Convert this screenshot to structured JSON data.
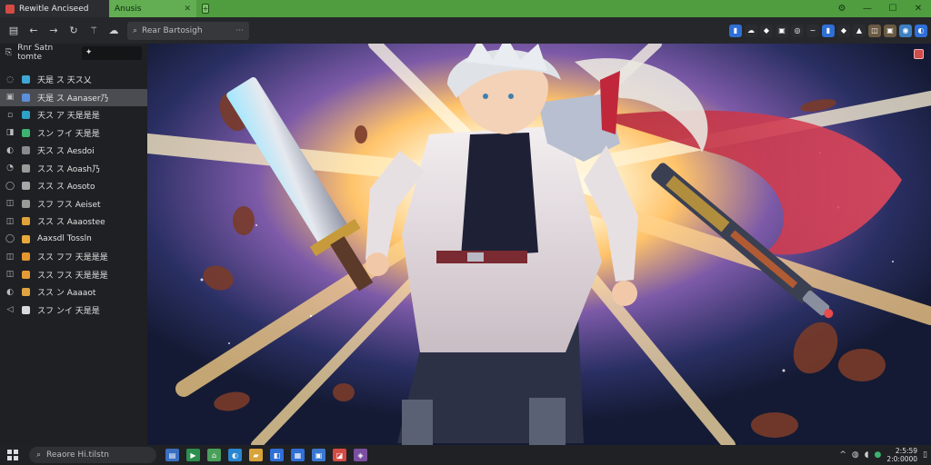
{
  "tabs": [
    {
      "label": "Rewitle Anciseed",
      "active": true
    },
    {
      "label": "Anusis",
      "active": false
    }
  ],
  "window_controls": {
    "settings": "⚙",
    "minimize": "—",
    "maximize": "☐",
    "close": "✕"
  },
  "toolbar": {
    "address_text": "Rear Bartosigh",
    "address_more": "···"
  },
  "sidebar": {
    "header_label": "Rnr Satn tomte",
    "search_value": "✦",
    "items": [
      {
        "glyph": "◌",
        "icon_color": "#3fa7d6",
        "label": "天是 ス 天ス乂"
      },
      {
        "glyph": "▣",
        "icon_color": "#5b8fd9",
        "label": "天是 ス Aanaser乃",
        "active": true
      },
      {
        "glyph": "▫",
        "icon_color": "#2ea1c9",
        "label": "天ス ア 天是是是"
      },
      {
        "glyph": "◨",
        "icon_color": "#3cb371",
        "label": "スン フイ 天是是"
      },
      {
        "glyph": "◐",
        "icon_color": "#8a8a8a",
        "label": "天ス ス Aesdoi"
      },
      {
        "glyph": "◔",
        "icon_color": "#9a9a9a",
        "label": "スス ス Aoash乃"
      },
      {
        "glyph": "◯",
        "icon_color": "#a7a7a7",
        "label": "スス ス Aosoto"
      },
      {
        "glyph": "◫",
        "icon_color": "#9a9a9a",
        "label": "スフ フス Aeiset"
      },
      {
        "glyph": "◫",
        "icon_color": "#e0a33a",
        "label": "スス ス Aaaostee"
      },
      {
        "glyph": "◯",
        "icon_color": "#e7a93b",
        "label": "Aaxsdl Tossln"
      },
      {
        "glyph": "◫",
        "icon_color": "#e6962f",
        "label": "スス フフ 天是是是"
      },
      {
        "glyph": "◫",
        "icon_color": "#e69a35",
        "label": "スス フス 天是是是"
      },
      {
        "glyph": "◐",
        "icon_color": "#e1a341",
        "label": "スス ン Aaaaot"
      },
      {
        "glyph": "◁",
        "icon_color": "#d9d9d9",
        "label": "スフ ンイ 天是是"
      }
    ]
  },
  "extensions": [
    {
      "name": "ext-1",
      "color": "#2f6fd6",
      "glyph": "▮"
    },
    {
      "name": "ext-2",
      "color": "#2a2c2f",
      "glyph": "☁"
    },
    {
      "name": "ext-3",
      "color": "#2a2c2f",
      "glyph": "◆"
    },
    {
      "name": "ext-4",
      "color": "#2a2c2f",
      "glyph": "▣"
    },
    {
      "name": "ext-5",
      "color": "#2a2c2f",
      "glyph": "◎"
    },
    {
      "name": "ext-6",
      "color": "#2a2c2f",
      "glyph": "~"
    },
    {
      "name": "ext-7",
      "color": "#2f6fd6",
      "glyph": "▮"
    },
    {
      "name": "ext-8",
      "color": "#2a2c2f",
      "glyph": "◆"
    },
    {
      "name": "ext-9",
      "color": "#2a2c2f",
      "glyph": "▲"
    },
    {
      "name": "ext-10",
      "color": "#6a5a43",
      "glyph": "◫"
    },
    {
      "name": "ext-11",
      "color": "#6a5a43",
      "glyph": "▣"
    },
    {
      "name": "ext-12",
      "color": "#3e7fc2",
      "glyph": "◉"
    },
    {
      "name": "ext-13",
      "color": "#2f6fd6",
      "glyph": "◐"
    }
  ],
  "taskbar": {
    "search_text": "Reaore Hi.tilstn",
    "clock_time": "2:5:59",
    "clock_date": "2:0:0000",
    "apps": [
      {
        "color": "#3a6fc1",
        "glyph": "▤"
      },
      {
        "color": "#2d8f4e",
        "glyph": "▶"
      },
      {
        "color": "#4aa05b",
        "glyph": "⌂"
      },
      {
        "color": "#2b86d1",
        "glyph": "◐"
      },
      {
        "color": "#d8a33a",
        "glyph": "▰"
      },
      {
        "color": "#2f6fd6",
        "glyph": "◧"
      },
      {
        "color": "#2f6fd6",
        "glyph": "▦"
      },
      {
        "color": "#3a78d0",
        "glyph": "▣"
      },
      {
        "color": "#d44b44",
        "glyph": "◪"
      },
      {
        "color": "#7b4fa0",
        "glyph": "◈"
      }
    ]
  }
}
